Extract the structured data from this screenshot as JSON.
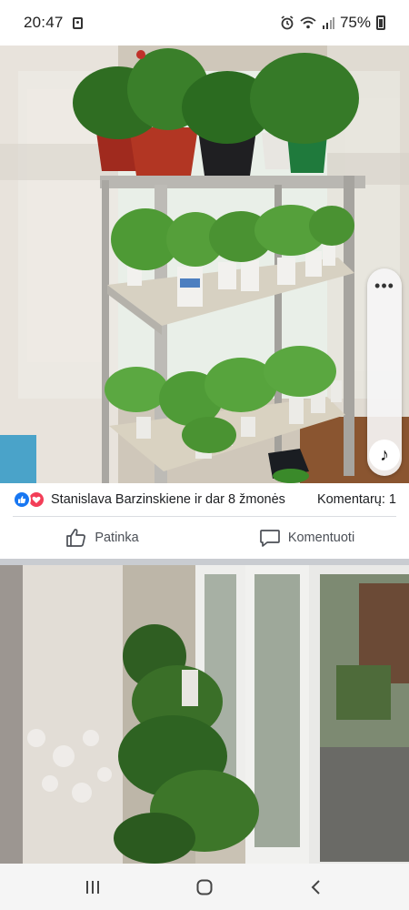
{
  "status_bar": {
    "time": "20:47",
    "battery": "75%"
  },
  "post": {
    "reactions_text": "Stanislava Barzinskiene ir dar 8 žmonės",
    "comments_text": "Komentarų: 1",
    "like_label": "Patinka",
    "comment_label": "Komentuoti"
  },
  "side_widget": {
    "menu_icon": "more-dots-icon",
    "music_icon": "music-note-icon"
  },
  "colors": {
    "like_blue": "#1877f2",
    "love_red": "#f33e58",
    "text_gray": "#4b4f56"
  }
}
